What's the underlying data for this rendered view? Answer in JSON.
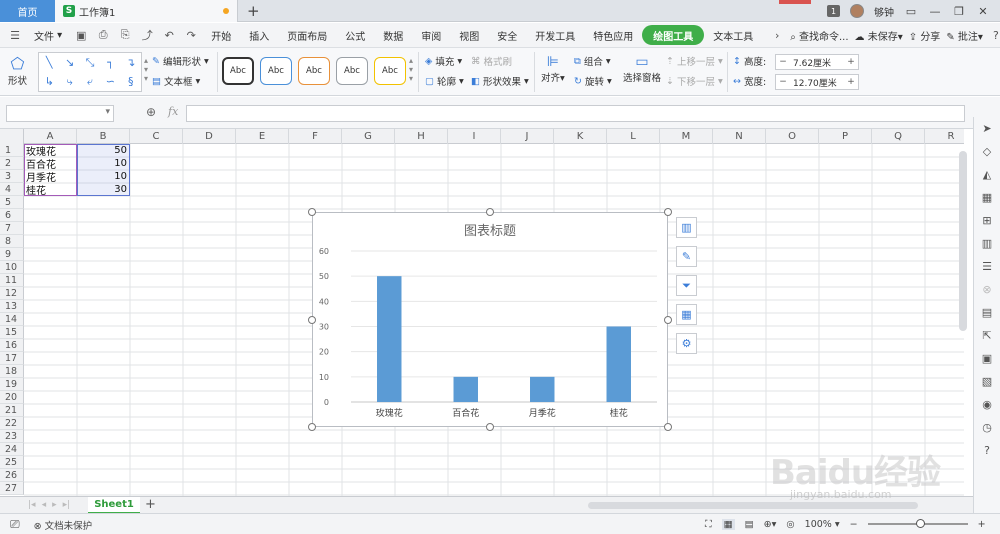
{
  "titlebar": {
    "home_tab": "首页",
    "doc_tab": "工作簿1",
    "doc_icon": "S",
    "new_tab": "+",
    "user_badge": "1",
    "user_name": "够钟"
  },
  "menu": {
    "file": "文件",
    "items": [
      "开始",
      "插入",
      "页面布局",
      "公式",
      "数据",
      "审阅",
      "视图",
      "安全",
      "开发工具",
      "特色应用",
      "绘图工具",
      "文本工具"
    ],
    "active_item": "绘图工具",
    "search": "查找命令...",
    "unsaved": "未保存",
    "share": "分享",
    "comment": "批注"
  },
  "ribbon": {
    "shape_label": "形状",
    "edit_shape": "编辑形状",
    "text_box": "文本框",
    "style_label": "Abc",
    "style_colors": [
      "#333333",
      "#4a90d9",
      "#e8913a",
      "#9aa0a6",
      "#f2c200"
    ],
    "fill": "填充",
    "format_brush": "格式刷",
    "outline": "轮廓",
    "shape_effect": "形状效果",
    "align": "对齐",
    "group": "组合",
    "rotate": "旋转",
    "select_pane": "选择窗格",
    "bring_forward": "上移一层",
    "send_backward": "下移一层",
    "height_label": "高度:",
    "height_value": "7.62厘米",
    "width_label": "宽度:",
    "width_value": "12.70厘米"
  },
  "formula": {
    "fx": "fx",
    "value": ""
  },
  "grid": {
    "columns": [
      "A",
      "B",
      "C",
      "D",
      "E",
      "F",
      "G",
      "H",
      "I",
      "J",
      "K",
      "L",
      "M",
      "N",
      "O",
      "P",
      "Q",
      "R"
    ],
    "rows": [
      "1",
      "2",
      "3",
      "4",
      "5",
      "6",
      "7",
      "8",
      "9",
      "10",
      "11",
      "12",
      "13",
      "14",
      "15",
      "16",
      "17",
      "18",
      "19",
      "20",
      "21",
      "22",
      "23",
      "24",
      "25",
      "26",
      "27"
    ],
    "cells": [
      {
        "col": "A",
        "row": 1,
        "value": "玫瑰花"
      },
      {
        "col": "B",
        "row": 1,
        "value": "50"
      },
      {
        "col": "A",
        "row": 2,
        "value": "百合花"
      },
      {
        "col": "B",
        "row": 2,
        "value": "10"
      },
      {
        "col": "A",
        "row": 3,
        "value": "月季花"
      },
      {
        "col": "B",
        "row": 3,
        "value": "10"
      },
      {
        "col": "A",
        "row": 4,
        "value": "桂花"
      },
      {
        "col": "B",
        "row": 4,
        "value": "30"
      }
    ]
  },
  "chart_data": {
    "type": "bar",
    "title": "图表标题",
    "categories": [
      "玫瑰花",
      "百合花",
      "月季花",
      "桂花"
    ],
    "values": [
      50,
      10,
      10,
      30
    ],
    "ylim": [
      0,
      60
    ],
    "yticks": [
      "0",
      "10",
      "20",
      "30",
      "40",
      "50",
      "60"
    ],
    "grid": true,
    "bar_color": "#5b9bd5"
  },
  "chart_tools": [
    "chart-elements-icon",
    "chart-style-icon",
    "chart-filter-icon",
    "chart-type-icon",
    "chart-settings-icon"
  ],
  "sheets": {
    "active": "Sheet1",
    "add": "+"
  },
  "status": {
    "protect": "文档未保护",
    "zoom": "100%",
    "zoom_minus": "−",
    "zoom_plus": "+"
  },
  "watermark": {
    "brand": "Baidu经验",
    "url": "jingyan.baidu.com"
  }
}
